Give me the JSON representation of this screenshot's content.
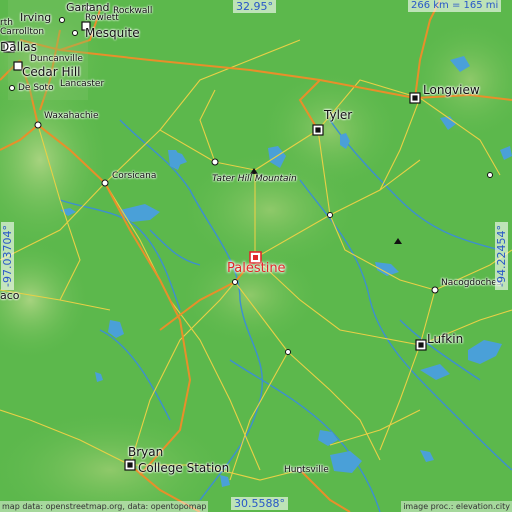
{
  "map": {
    "place": "Palestine",
    "scale_label": "266 km = 165 mi",
    "lat_top": "32.95°",
    "lat_bottom": "30.5588°",
    "lon_left": "-97.03704°",
    "lon_right": "-94.22454°",
    "credit_left": "map data: openstreetmap.org, data: opentopomap",
    "credit_right": "image proc.: elevation.city",
    "colors": {
      "land": "#5fba4e",
      "highland": "#9fd07a",
      "water": "#4aa0d8",
      "road_major": "#e88f2a",
      "road_minor": "#e8d046",
      "label_main": "#e0282a",
      "coord_text": "#2857c8"
    }
  },
  "cities": {
    "garland": "Garland",
    "irving": "Irving",
    "rowlett": "Rowlett",
    "rockwall": "Rockwall",
    "carrollton": "Carrollton",
    "dallas": "Dallas",
    "mesquite": "Mesquite",
    "duncanville": "Duncanville",
    "cedar_hill": "Cedar Hill",
    "desoto": "De Soto",
    "lancaster": "Lancaster",
    "waxahachie": "Waxahachie",
    "corsicana": "Corsicana",
    "tyler": "Tyler",
    "longview": "Longview",
    "tater_hill": "Tater Hill Mountain",
    "nacogdoches": "Nacogdoches",
    "lufkin": "Lufkin",
    "huntsville": "Huntsville",
    "bryan": "Bryan",
    "college_station": "College Station",
    "waco_partial": "aco",
    "north_partial": "rth"
  },
  "icons": [
    "town-marker-icon",
    "city-square-icon",
    "summit-triangle-icon",
    "palestine-marker-icon"
  ]
}
